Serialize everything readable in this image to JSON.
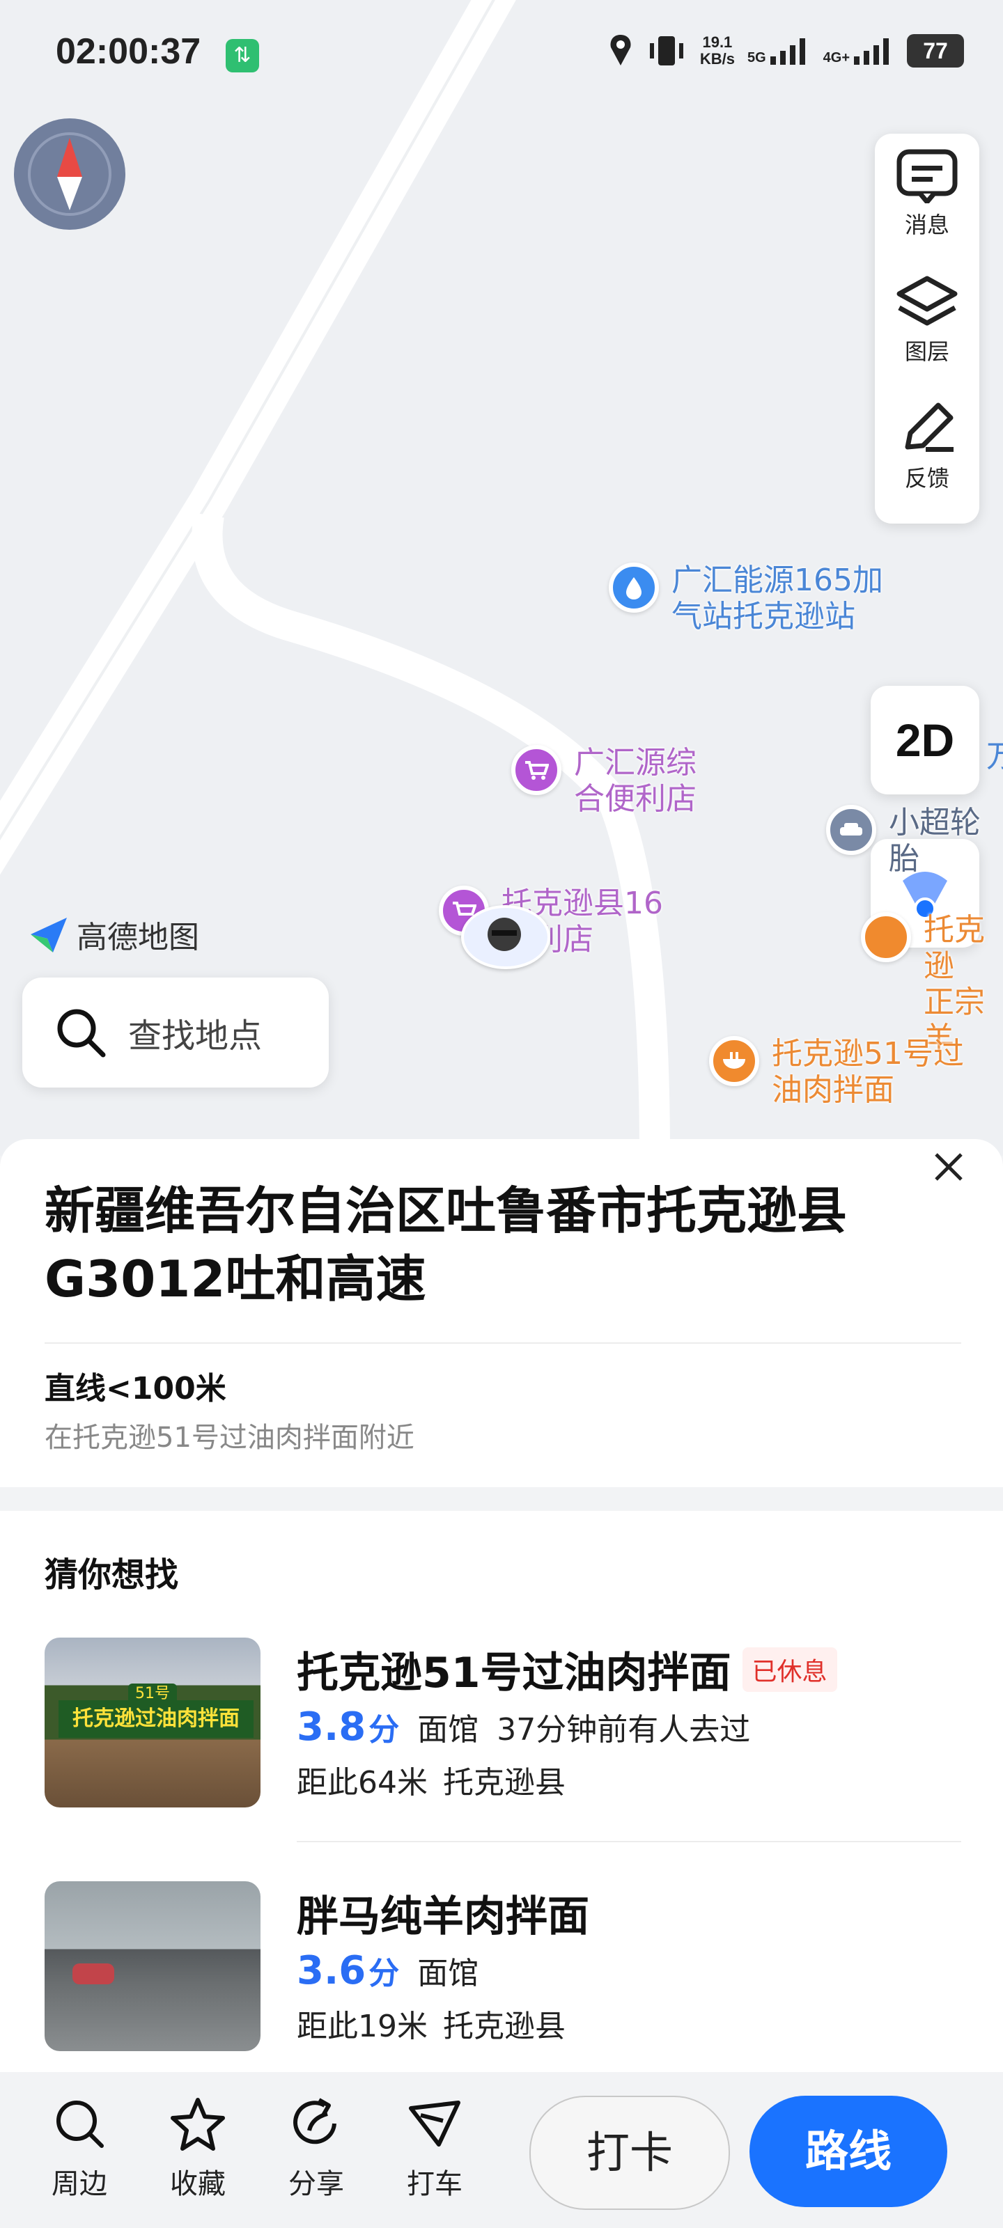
{
  "status": {
    "time": "02:00:37",
    "speed_value": "19.1",
    "speed_unit": "KB/s",
    "net1": "5G",
    "net2": "4G+",
    "battery": "77"
  },
  "toolbar": {
    "messages": "消息",
    "layers": "图层",
    "feedback": "反馈"
  },
  "map_controls": {
    "view_mode": "2D"
  },
  "map_pois": {
    "gas_station": "广汇能源165加\n气站托克逊站",
    "convenience_store_1": "广汇源综\n合便利店",
    "convenience_store_2": "托克逊县16\n便利店",
    "tire_shop": "小超轮胎",
    "noodle_shop": "托克逊51号过\n油肉拌面",
    "right_partial_top": "万",
    "right_partial_mid": "托克逊\n正宗羊"
  },
  "brand": {
    "logo_text": "高德地图"
  },
  "search": {
    "placeholder": "查找地点"
  },
  "location_sheet": {
    "address": "新疆维吾尔自治区吐鲁番市托克逊县G3012吐和高速",
    "distance": "直线<100米",
    "nearby": "在托克逊51号过油肉拌面附近"
  },
  "suggestions": {
    "title": "猜你想找",
    "items": [
      {
        "name": "托克逊51号过油肉拌面",
        "status": "已休息",
        "rating": "3.8",
        "rating_unit": "分",
        "category": "面馆",
        "note": "37分钟前有人去过",
        "distance": "距此64米",
        "area": "托克逊县",
        "sign_badge": "51号",
        "sign_text": "托克逊过油肉拌面"
      },
      {
        "name": "胖马纯羊肉拌面",
        "status": "",
        "rating": "3.6",
        "rating_unit": "分",
        "category": "面馆",
        "note": "",
        "distance": "距此19米",
        "area": "托克逊县"
      }
    ]
  },
  "bottom_bar": {
    "nearby": "周边",
    "favorite": "收藏",
    "share": "分享",
    "taxi": "打车",
    "checkin": "打卡",
    "route": "路线"
  },
  "colors": {
    "accent": "#1a73ff",
    "rating": "#2a6df4",
    "closed": "#e0302a"
  }
}
